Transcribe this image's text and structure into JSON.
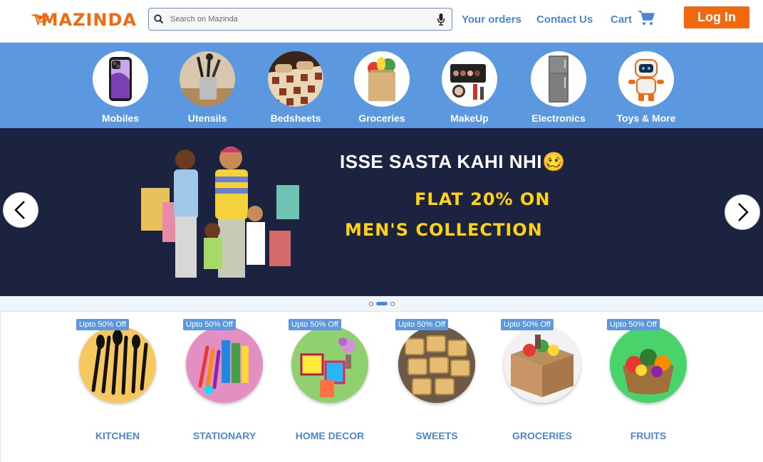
{
  "header": {
    "logo_text": "MAZINDA",
    "search_placeholder": "Search on Mazinda",
    "nav": {
      "orders": "Your orders",
      "contact": "Contact Us",
      "cart": "Cart"
    },
    "login_label": "Log In"
  },
  "categories": [
    {
      "label": "Mobiles",
      "icon": "phone-icon"
    },
    {
      "label": "Utensils",
      "icon": "utensils-icon"
    },
    {
      "label": "Bedsheets",
      "icon": "bedsheet-icon"
    },
    {
      "label": "Groceries",
      "icon": "grocery-bag-icon"
    },
    {
      "label": "MakeUp",
      "icon": "makeup-icon"
    },
    {
      "label": "Electronics",
      "icon": "fridge-icon"
    },
    {
      "label": "Toys & More",
      "icon": "robot-toy-icon"
    }
  ],
  "banner": {
    "headline": "ISSE SASTA KAHI NHI",
    "emoji": "🥴",
    "offer_line1": "FLAT 20% ON",
    "offer_line2": "MEN'S COLLECTION",
    "slide_count": 3,
    "active_slide": 2
  },
  "offers": [
    {
      "badge": "Upto 50% Off",
      "label": "KITCHEN",
      "color": "#f6c85f"
    },
    {
      "badge": "Upto 50% Off",
      "label": "STATIONARY",
      "color": "#e48fc1"
    },
    {
      "badge": "Upto 50% Off",
      "label": "HOME DECOR",
      "color": "#8fd16e"
    },
    {
      "badge": "Upto 50% Off",
      "label": "SWEETS",
      "color": "#e7c07a"
    },
    {
      "badge": "Upto 50% Off",
      "label": "GROCERIES",
      "color": "#c99565"
    },
    {
      "badge": "Upto 50% Off",
      "label": "FRUITS",
      "color": "#49d36b"
    }
  ],
  "colors": {
    "brand_orange": "#f2680f",
    "brand_blue": "#5b98df",
    "banner_bg": "#1c2340",
    "offer_yellow": "#ffd21a"
  }
}
